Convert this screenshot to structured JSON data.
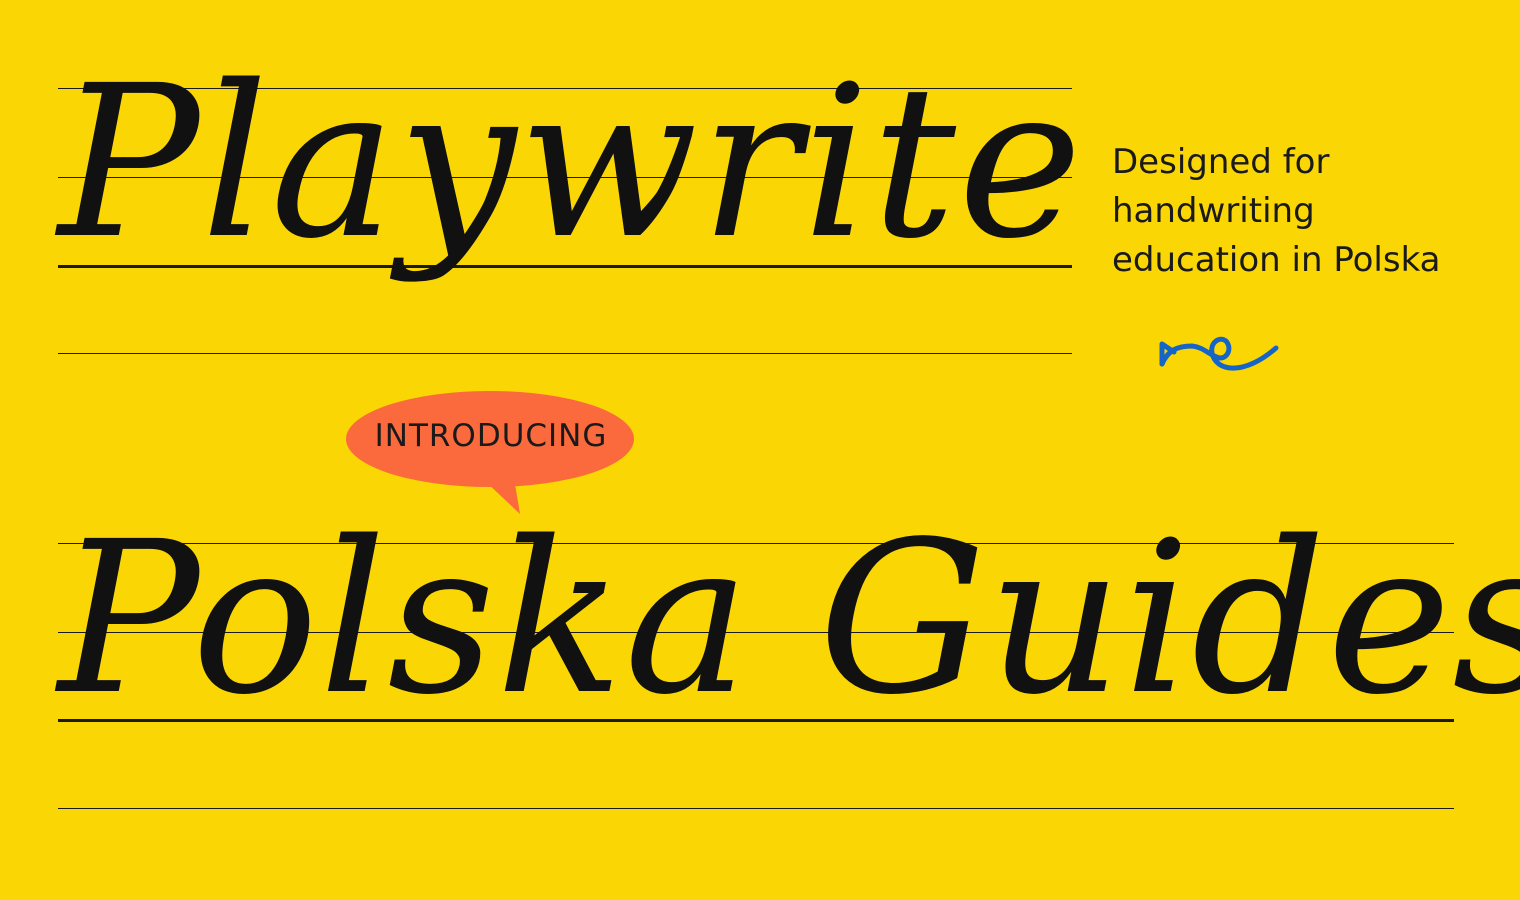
{
  "headline_1": "Playwrite",
  "headline_2": "Polska Guides",
  "tagline": [
    "Designed for",
    "handwriting",
    "education in Polska"
  ],
  "badge": "INTRODUCING",
  "colors": {
    "background": "#FAD604",
    "ink": "#111111",
    "badge": "#FA6A3C",
    "accent": "#1565C8"
  },
  "icons": [
    "swirl-arrow-icon",
    "speech-bubble"
  ]
}
